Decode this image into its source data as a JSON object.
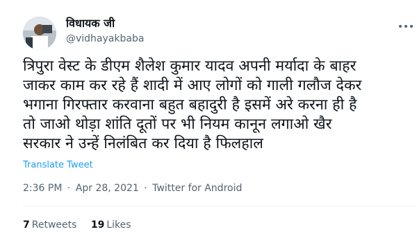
{
  "user": {
    "display_name": "विधायक जी",
    "handle": "@vidhayakbaba",
    "avatar_icon": "profile-photo"
  },
  "menu_icon": "more-dots-icon",
  "tweet": {
    "text": "त्रिपुरा वेस्ट के डीएम शैलेश कुमार यादव अपनी मर्यादा के बाहर\nजाकर काम कर रहे हैं शादी में आए लोगों को गाली गलौज देकर\nभगाना गिरफ्तार करवाना बहुत बहादुरी है इसमें अरे करना ही है\nतो जाओ थोड़ा शांति दूतों पर भी नियम कानून लगाओ खैर\nसरकार ने उन्हें निलंबित कर दिया है फिलहाल",
    "translate_label": "Translate Tweet"
  },
  "meta": {
    "time": "2:36 PM",
    "date": "Apr 28, 2021",
    "source": "Twitter for Android",
    "separator": "·"
  },
  "stats": {
    "retweets_count": "7",
    "retweets_label": "Retweets",
    "likes_count": "19",
    "likes_label": "Likes"
  },
  "colors": {
    "link": "#1d9bf0",
    "secondary_text": "#536471",
    "primary_text": "#0f1419",
    "divider": "#eff3f4"
  }
}
